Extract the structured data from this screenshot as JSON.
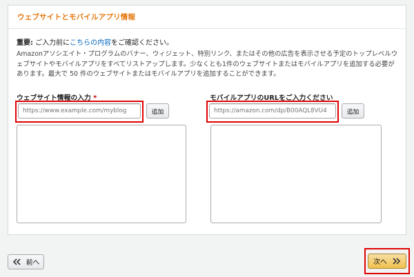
{
  "panel": {
    "title": "ウェブサイトとモバイルアプリ情報",
    "notice": {
      "strong": "重要:",
      "before": " ご入力前に",
      "link": "こちらの内容",
      "after": "をご確認ください。"
    },
    "description": "Amazonアソシエイト・プログラムのバナー、ウィジェット、特別リンク、またはその他の広告を表示させる予定のトップレベルウェブサイトやモバイルアプリをすべてリストアップします。少なくとも1件のウェブサイトまたはモバイルアプリを追加する必要があります。最大で 50 件のウェブサイトまたはモバイルアプリを追加することができます。"
  },
  "website": {
    "label": "ウェブサイト情報の入力",
    "required": "*",
    "placeholder": "https://www.example.com/myblog",
    "add_label": "追加"
  },
  "mobile": {
    "label": "モバイルアプリのURLをご入力ください",
    "placeholder": "https://amazon.com/dp/B00AQL8VU4",
    "add_label": "追加"
  },
  "footer": {
    "prev_label": "前へ",
    "next_label": "次へ"
  },
  "colors": {
    "title": "#e47911",
    "link": "#0066c0",
    "highlight": "#e00000",
    "next_button": "#f0c14b"
  },
  "icons": {
    "prev": "double-chevron-left-icon",
    "next": "double-chevron-right-icon"
  }
}
